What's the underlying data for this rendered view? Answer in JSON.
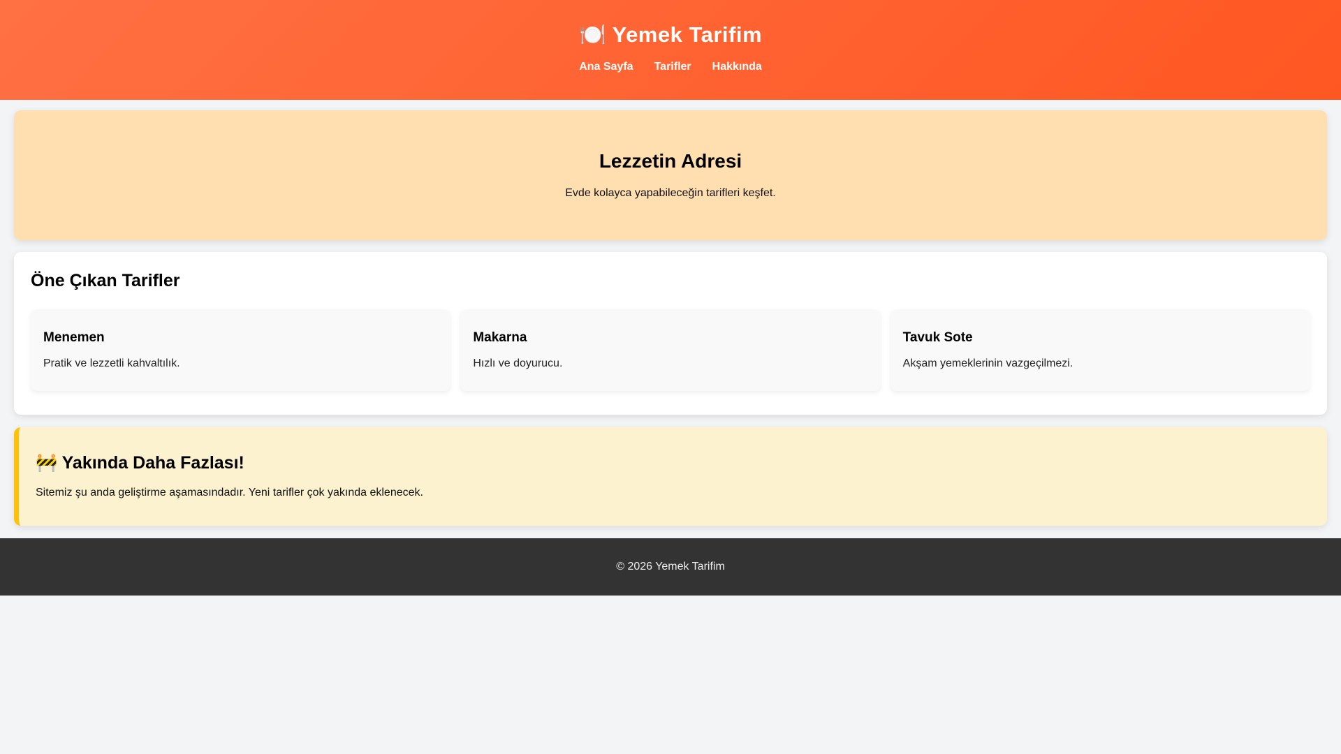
{
  "header": {
    "title": "🍽️ Yemek Tarifim",
    "nav": [
      {
        "label": "Ana Sayfa"
      },
      {
        "label": "Tarifler"
      },
      {
        "label": "Hakkında"
      }
    ]
  },
  "hero": {
    "title": "Lezzetin Adresi",
    "subtitle": "Evde kolayca yapabileceğin tarifleri keşfet."
  },
  "featured": {
    "title": "Öne Çıkan Tarifler",
    "cards": [
      {
        "title": "Menemen",
        "description": "Pratik ve lezzetli kahvaltılık."
      },
      {
        "title": "Makarna",
        "description": "Hızlı ve doyurucu."
      },
      {
        "title": "Tavuk Sote",
        "description": "Akşam yemeklerinin vazgeçilmezi."
      }
    ]
  },
  "notice": {
    "title": "🚧 Yakında Daha Fazlası!",
    "text": "Sitemiz şu anda geliştirme aşamasındadır. Yeni tarifler çok yakında eklenecek."
  },
  "footer": {
    "copyright": "© 2026 Yemek Tarifim"
  },
  "colors": {
    "header_gradient_start": "#ff7043",
    "header_gradient_end": "#ff5722",
    "hero_background": "#ffdfb0",
    "notice_background": "#fdf2d0",
    "notice_border": "#ffc107",
    "card_background": "#f9f9f9",
    "page_background": "#f3f4f6",
    "footer_background": "#333333"
  }
}
